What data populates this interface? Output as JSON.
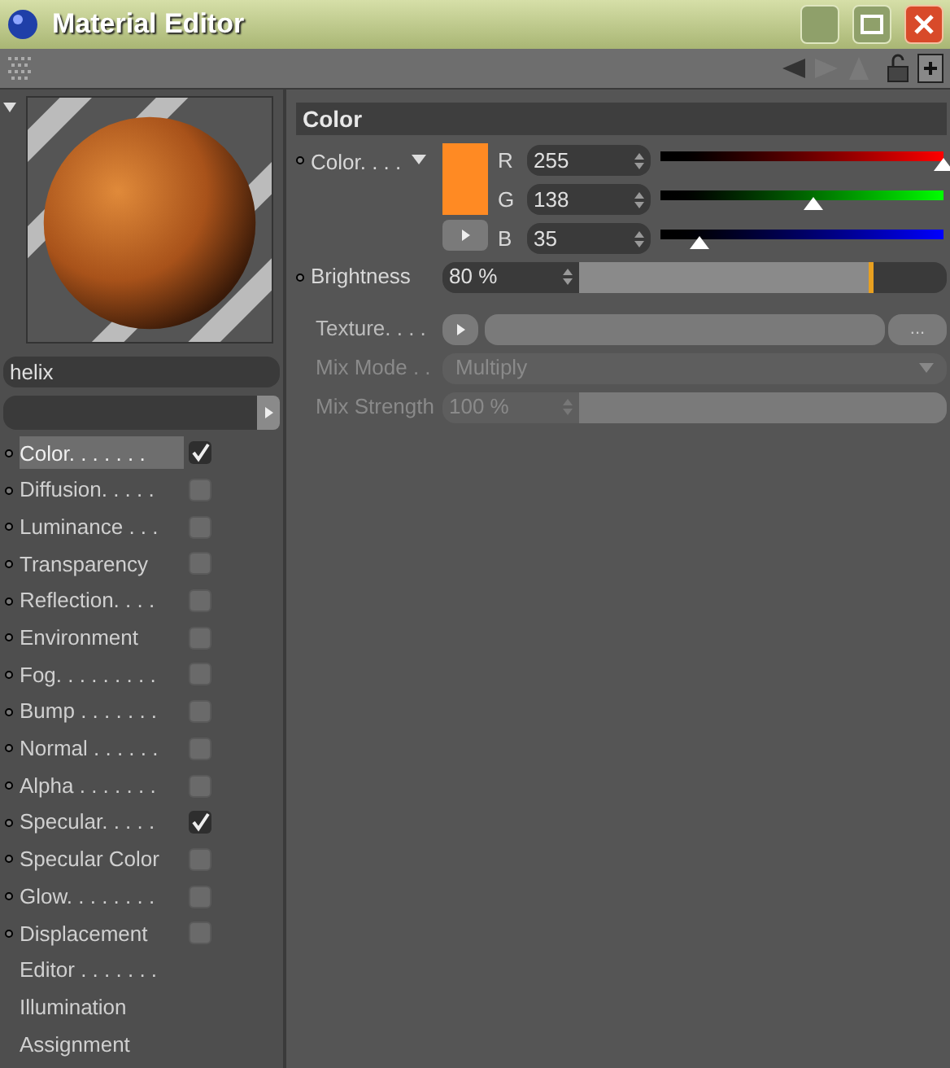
{
  "window": {
    "title": "Material Editor"
  },
  "material": {
    "name": "helix"
  },
  "channels": [
    {
      "kind": "channel",
      "label": "Color. . . . . . .",
      "checked": true,
      "selected": true
    },
    {
      "kind": "channel",
      "label": "Diffusion. . . . .",
      "checked": false,
      "selected": false
    },
    {
      "kind": "channel",
      "label": "Luminance . . .",
      "checked": false,
      "selected": false
    },
    {
      "kind": "channel",
      "label": "Transparency",
      "checked": false,
      "selected": false
    },
    {
      "kind": "channel",
      "label": "Reflection. . . .",
      "checked": false,
      "selected": false
    },
    {
      "kind": "channel",
      "label": "Environment",
      "checked": false,
      "selected": false
    },
    {
      "kind": "channel",
      "label": "Fog. . . . . . . . .",
      "checked": false,
      "selected": false
    },
    {
      "kind": "channel",
      "label": "Bump . . . . . . .",
      "checked": false,
      "selected": false
    },
    {
      "kind": "channel",
      "label": "Normal . . . . . .",
      "checked": false,
      "selected": false
    },
    {
      "kind": "channel",
      "label": "Alpha . . . . . . .",
      "checked": false,
      "selected": false
    },
    {
      "kind": "channel",
      "label": "Specular. . . . .",
      "checked": true,
      "selected": false
    },
    {
      "kind": "channel",
      "label": "Specular Color",
      "checked": false,
      "selected": false
    },
    {
      "kind": "channel",
      "label": "Glow. . . . . . . .",
      "checked": false,
      "selected": false
    },
    {
      "kind": "channel",
      "label": "Displacement",
      "checked": false,
      "selected": false
    },
    {
      "kind": "page",
      "label": "Editor . . . . . . .",
      "selected": false
    },
    {
      "kind": "page",
      "label": "Illumination",
      "selected": false
    },
    {
      "kind": "page",
      "label": "Assignment",
      "selected": false
    }
  ],
  "section": {
    "title": "Color",
    "color": {
      "label": "Color. . . .",
      "components": [
        {
          "label": "R",
          "value": "255",
          "level": 1.0
        },
        {
          "label": "G",
          "value": "138",
          "level": 0.54
        },
        {
          "label": "B",
          "value": "35",
          "level": 0.137
        }
      ]
    },
    "brightness": {
      "label": "Brightness",
      "value": "80 %",
      "level": 0.8
    },
    "texture": {
      "label": "Texture. . . .",
      "browse": "..."
    },
    "mix_mode": {
      "label": "Mix Mode . .",
      "value": "Multiply",
      "disabled": true
    },
    "mix_strength": {
      "label": "Mix Strength",
      "value": "100 %",
      "level": 1.0,
      "disabled": true
    }
  }
}
